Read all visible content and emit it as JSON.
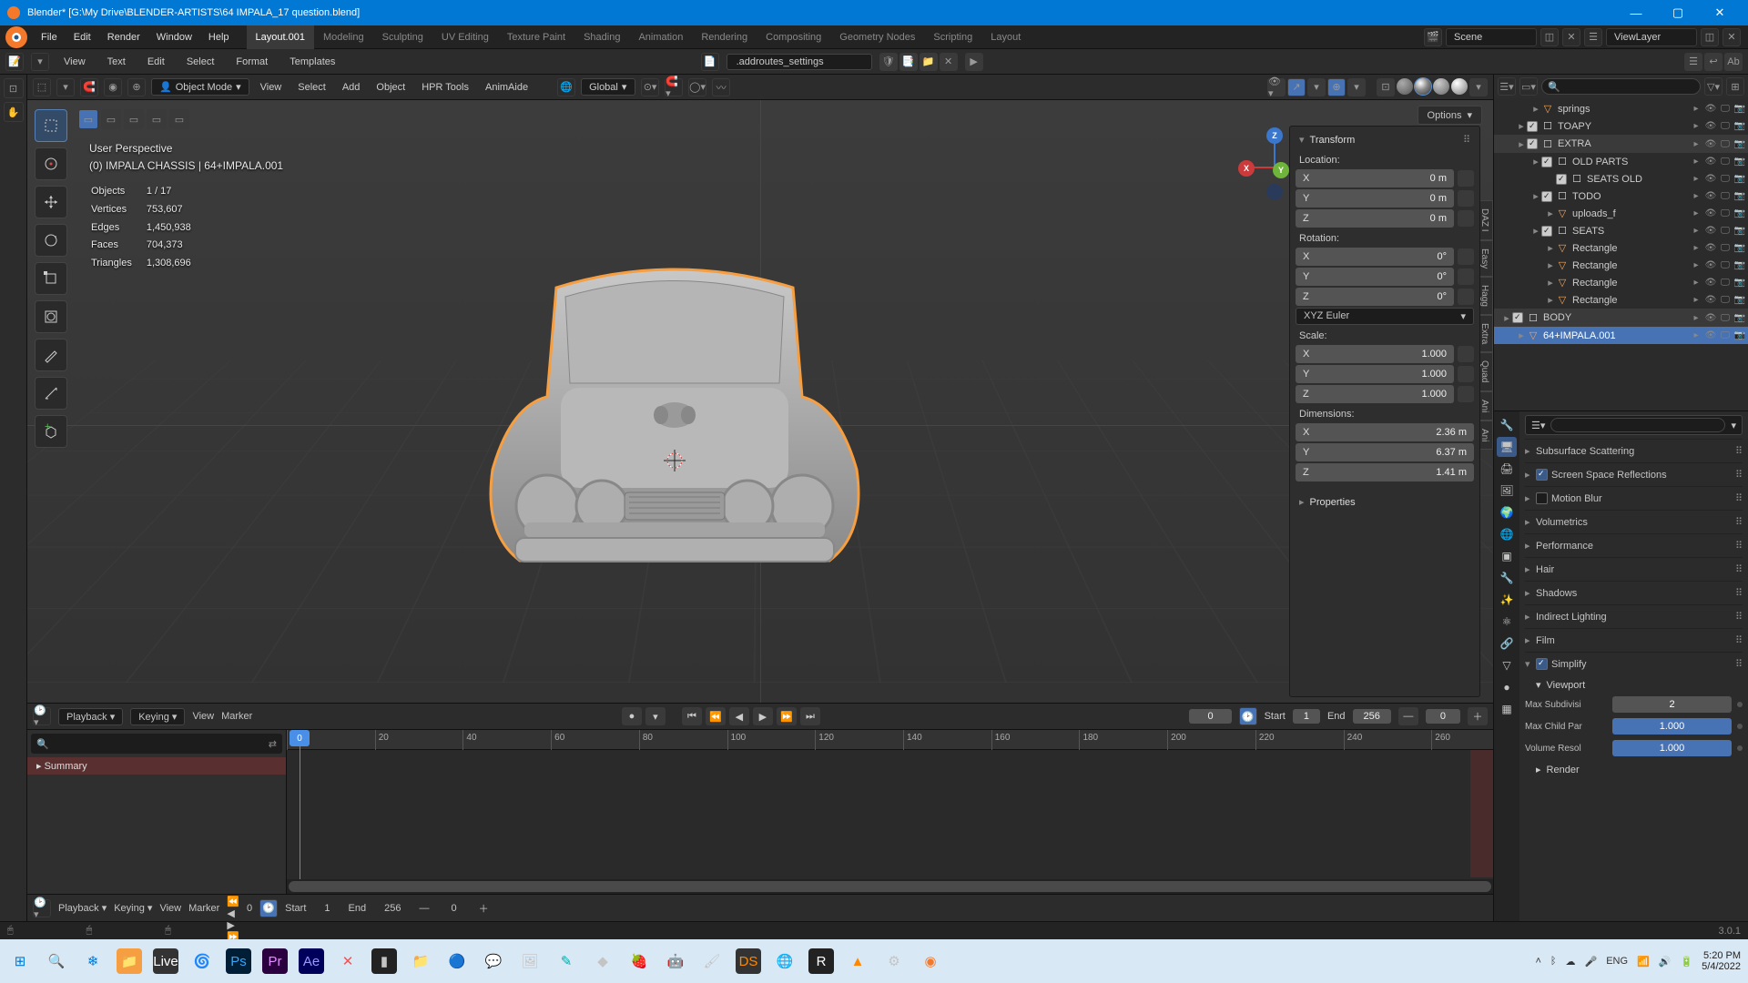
{
  "title": "Blender* [G:\\My Drive\\BLENDER-ARTISTS\\64 IMPALA_17 question.blend]",
  "menu": [
    "File",
    "Edit",
    "Render",
    "Window",
    "Help"
  ],
  "tabs": [
    "Layout.001",
    "Modeling",
    "Sculpting",
    "UV Editing",
    "Texture Paint",
    "Shading",
    "Animation",
    "Rendering",
    "Compositing",
    "Geometry Nodes",
    "Scripting",
    "Layout"
  ],
  "scene": {
    "scene": "Scene",
    "viewlayer": "ViewLayer"
  },
  "header2": {
    "menu": [
      "View",
      "Text",
      "Edit",
      "Select",
      "Format",
      "Templates"
    ],
    "docname": ".addroutes_settings"
  },
  "vp": {
    "mode": "Object Mode",
    "menu": [
      "View",
      "Select",
      "Add",
      "Object",
      "HPR Tools",
      "AnimAide"
    ],
    "orient": "Global",
    "options": "Options",
    "persp": "User Perspective",
    "collection": "(0) IMPALA CHASSIS | 64+IMPALA.001",
    "stats": [
      [
        "Objects",
        "1 / 17"
      ],
      [
        "Vertices",
        "753,607"
      ],
      [
        "Edges",
        "1,450,938"
      ],
      [
        "Faces",
        "704,373"
      ],
      [
        "Triangles",
        "1,308,696"
      ]
    ]
  },
  "transform": {
    "header": "Transform",
    "location": {
      "label": "Location:",
      "x": "0 m",
      "y": "0 m",
      "z": "0 m"
    },
    "rotation": {
      "label": "Rotation:",
      "x": "0°",
      "y": "0°",
      "z": "0°"
    },
    "rotmode": "XYZ Euler",
    "scale": {
      "label": "Scale:",
      "x": "1.000",
      "y": "1.000",
      "z": "1.000"
    },
    "dimensions": {
      "label": "Dimensions:",
      "x": "2.36 m",
      "y": "6.37 m",
      "z": "1.41 m"
    },
    "props": "Properties"
  },
  "outliner": {
    "rows": [
      {
        "depth": 2,
        "type": "obj",
        "name": "springs",
        "ctrls": true,
        "disc": true
      },
      {
        "depth": 1,
        "type": "coll",
        "name": "TOAPY",
        "hdr": false,
        "ctrls": true,
        "chk": true,
        "disc": true
      },
      {
        "depth": 1,
        "type": "coll",
        "name": "EXTRA",
        "hdr": true,
        "ctrls": true,
        "chk": true,
        "disc": true
      },
      {
        "depth": 2,
        "type": "coll",
        "name": "OLD PARTS",
        "ctrls": true,
        "chk": true,
        "disc": true
      },
      {
        "depth": 3,
        "type": "coll",
        "name": "SEATS OLD",
        "ctrls": true,
        "chk": true
      },
      {
        "depth": 2,
        "type": "coll",
        "name": "TODO",
        "ctrls": true,
        "chk": true,
        "disc": true
      },
      {
        "depth": 3,
        "type": "obj",
        "name": "uploads_f",
        "ctrls": true,
        "disc": true
      },
      {
        "depth": 2,
        "type": "coll",
        "name": "SEATS",
        "ctrls": true,
        "chk": true,
        "disc": true
      },
      {
        "depth": 3,
        "type": "obj",
        "name": "Rectangle",
        "ctrls": true,
        "disc": true
      },
      {
        "depth": 3,
        "type": "obj",
        "name": "Rectangle",
        "ctrls": true,
        "disc": true
      },
      {
        "depth": 3,
        "type": "obj",
        "name": "Rectangle",
        "ctrls": true,
        "disc": true
      },
      {
        "depth": 3,
        "type": "obj",
        "name": "Rectangle",
        "ctrls": true,
        "disc": true
      },
      {
        "depth": 0,
        "type": "coll",
        "name": "BODY",
        "hdr": true,
        "ctrls": true,
        "chk": true,
        "disc": true
      },
      {
        "depth": 1,
        "type": "obj",
        "name": "64+IMPALA.001",
        "sel": true,
        "ctrls": true,
        "disc": true
      }
    ]
  },
  "props": {
    "panels": [
      {
        "label": "Subsurface Scattering"
      },
      {
        "label": "Screen Space Reflections",
        "check": true
      },
      {
        "label": "Motion Blur",
        "check": false
      },
      {
        "label": "Volumetrics"
      },
      {
        "label": "Performance"
      },
      {
        "label": "Hair"
      },
      {
        "label": "Shadows"
      },
      {
        "label": "Indirect Lighting"
      },
      {
        "label": "Film"
      }
    ],
    "simplify": {
      "label": "Simplify",
      "viewport": "Viewport",
      "maxsub_label": "Max Subdivisi",
      "maxsub": "2",
      "maxchild_label": "Max Child Par",
      "maxchild": "1.000",
      "volres_label": "Volume Resol",
      "volres": "1.000",
      "render": "Render"
    }
  },
  "timeline": {
    "playback": "Playback",
    "keying": "Keying",
    "view": "View",
    "marker": "Marker",
    "current": "0",
    "start_label": "Start",
    "start": "1",
    "end_label": "End",
    "end": "256",
    "zero": "0",
    "summary": "Summary",
    "ticks": [
      "0",
      "20",
      "40",
      "60",
      "80",
      "100",
      "120",
      "140",
      "160",
      "180",
      "200",
      "220",
      "240",
      "260"
    ],
    "playhead": "0"
  },
  "version": "3.0.1",
  "clock": {
    "time": "5:20 PM",
    "date": "5/4/2022"
  }
}
